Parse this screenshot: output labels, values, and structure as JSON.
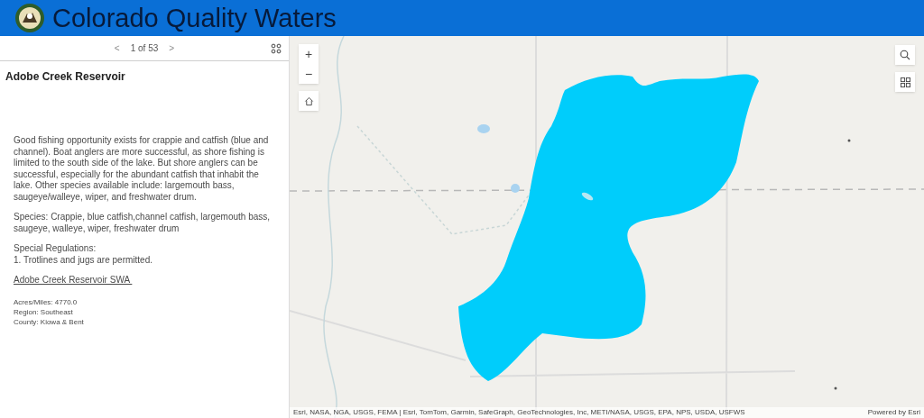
{
  "header": {
    "title": "Colorado Quality Waters"
  },
  "panel": {
    "pager": {
      "prev": "<",
      "position": "1 of 53",
      "next": ">"
    },
    "title": "Adobe Creek Reservoir",
    "paragraphs": [
      "Good fishing opportunity exists for crappie and catfish (blue and channel). Boat anglers are more successful, as shore fishing is limited to the south side of the lake. But shore anglers can be successful, especially for the abundant catfish that inhabit the lake. Other species available include: largemouth bass, saugeye/walleye, wiper, and freshwater drum.",
      "Species: Crappie, blue catfish,channel catfish, largemouth bass, saugeye, walleye, wiper, freshwater drum"
    ],
    "regulations": [
      "Special Regulations:",
      "1. Trotlines and jugs are permitted."
    ],
    "link": "Adobe Creek Reservoir SWA ",
    "facts": [
      "Acres/Miles: 4770.0",
      "Region: Southeast",
      "County: Kiowa & Bent"
    ]
  },
  "map": {
    "zoom_in": "+",
    "zoom_out": "−",
    "attribution": "Esri, NASA, NGA, USGS, FEMA | Esri, TomTom, Garmin, SafeGraph, GeoTechnologies, Inc, METI/NASA, USGS, EPA, NPS, USDA, USFWS",
    "powered_by": "Powered by Esri"
  }
}
